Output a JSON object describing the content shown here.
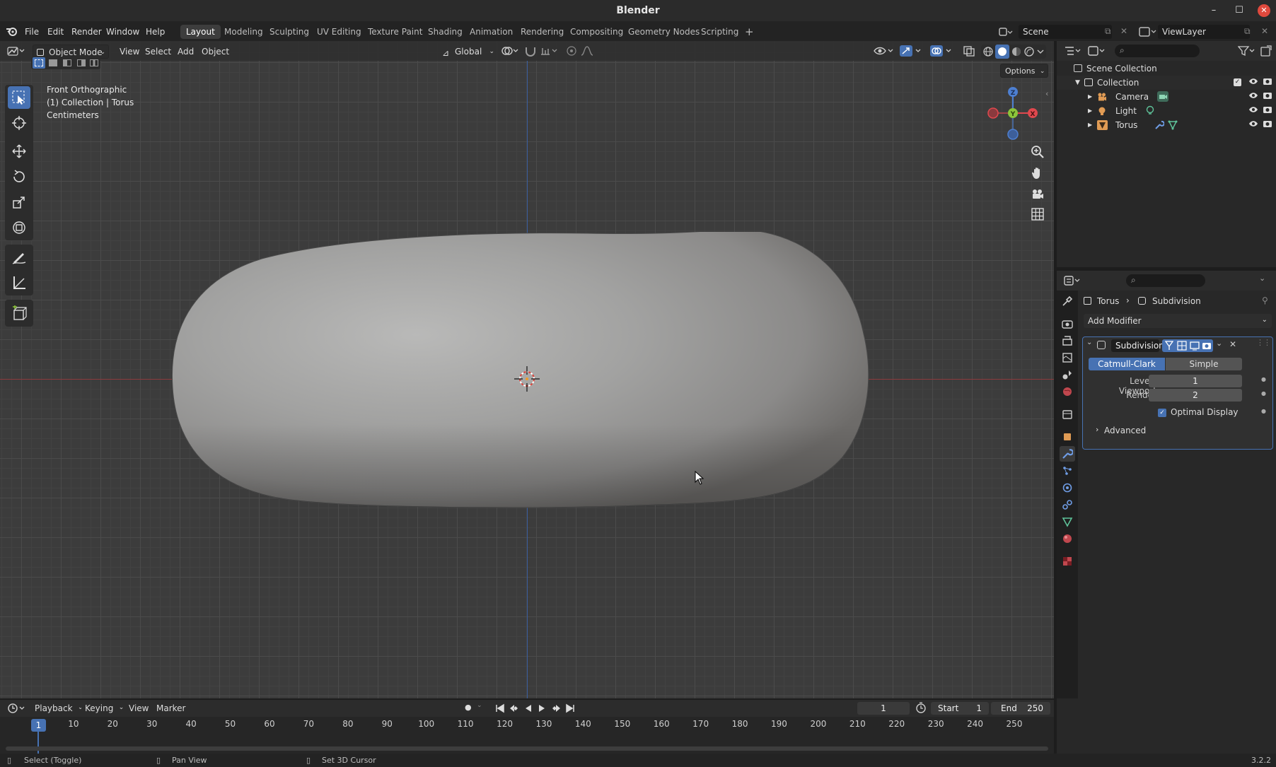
{
  "window": {
    "title": "Blender",
    "controls": [
      "–",
      "☐",
      "✕"
    ]
  },
  "menu": [
    "File",
    "Edit",
    "Render",
    "Window",
    "Help"
  ],
  "workspaces": [
    {
      "label": "Layout",
      "active": true
    },
    {
      "label": "Modeling"
    },
    {
      "label": "Sculpting"
    },
    {
      "label": "UV Editing"
    },
    {
      "label": "Texture Paint"
    },
    {
      "label": "Shading"
    },
    {
      "label": "Animation"
    },
    {
      "label": "Rendering"
    },
    {
      "label": "Compositing"
    },
    {
      "label": "Geometry Nodes"
    },
    {
      "label": "Scripting"
    },
    {
      "label": "+"
    }
  ],
  "scene": {
    "name": "Scene",
    "view_layer": "ViewLayer"
  },
  "viewport_header": {
    "mode": "Object Mode",
    "menus": [
      "View",
      "Select",
      "Add",
      "Object"
    ],
    "orientation": "Global",
    "options": "Options"
  },
  "viewport_info": {
    "view": "Front Orthographic",
    "collection": "(1) Collection | Torus",
    "units": "Centimeters"
  },
  "gizmo": {
    "z": "Z",
    "y": "Y",
    "x": "X"
  },
  "tools": [
    "select-box",
    "cursor",
    "move",
    "rotate",
    "scale",
    "transform",
    "annotate",
    "measure",
    "add-cube"
  ],
  "outliner": {
    "root": "Scene Collection",
    "collection": "Collection",
    "items": [
      {
        "label": "Camera",
        "icon": "camera-icon"
      },
      {
        "label": "Light",
        "icon": "light-icon"
      },
      {
        "label": "Torus",
        "icon": "mesh-icon"
      }
    ]
  },
  "properties": {
    "breadcrumb": {
      "object": "Torus",
      "modifier": "Subdivision"
    },
    "add_modifier": "Add Modifier",
    "modifier": {
      "name": "Subdivision",
      "tab_catmull": "Catmull-Clark",
      "tab_simple": "Simple",
      "levels_viewport_label": "Levels Viewport",
      "levels_viewport": "1",
      "render_label": "Render",
      "render": "2",
      "optimal_display": "Optimal Display",
      "optimal_display_checked": true,
      "advanced": "Advanced"
    }
  },
  "timeline": {
    "menus": [
      "Playback",
      "Keying",
      "View",
      "Marker"
    ],
    "current_frame": "1",
    "start_label": "Start",
    "start": "1",
    "end_label": "End",
    "end": "250",
    "ruler": [
      "1",
      "10",
      "20",
      "30",
      "40",
      "50",
      "60",
      "70",
      "80",
      "90",
      "100",
      "110",
      "120",
      "130",
      "140",
      "150",
      "160",
      "170",
      "180",
      "190",
      "200",
      "210",
      "220",
      "230",
      "240",
      "250"
    ]
  },
  "status": {
    "select": "Select (Toggle)",
    "pan": "Pan View",
    "cursor": "Set 3D Cursor",
    "version": "3.2.2"
  },
  "colors": {
    "accent": "#4772b3",
    "x_axis": "#e0484e",
    "y_axis": "#8bc43a",
    "z_axis": "#4d7fd1",
    "viewport_bg": "#3c3c3c"
  }
}
